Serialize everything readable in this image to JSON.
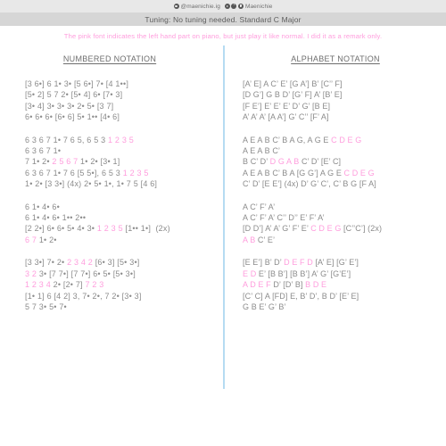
{
  "credit": {
    "handle": "@maenichie.ig",
    "name": "Maenichie",
    "icons": [
      "instagram-icon",
      "youtube-icon",
      "facebook-icon",
      "tiktok-icon"
    ]
  },
  "tuning": {
    "text": "Tuning: No tuning needed. Standard C Major"
  },
  "remark": {
    "text": "The pink font indicates the left hand part on piano, but just play it like normal. I did it as a remark only."
  },
  "colors": {
    "pink": "#ff9ddd",
    "gray_text": "#8c8c8c",
    "divider": "#b5dbf2",
    "credit_bar": "#e8e8e8",
    "tuning_bar": "#d6d6d6"
  },
  "columns": {
    "numbered": {
      "title": "NUMBERED NOTATION",
      "blocks": [
        {
          "lines": [
            [
              {
                "t": "[3 6•] 6 1• 3• [5 6•] 7• [4 1••]",
                "c": "gray"
              }
            ],
            [
              {
                "t": "[5• 2] 5 7 2• [5• 4] 6• [7• 3]",
                "c": "gray"
              }
            ],
            [
              {
                "t": "[3• 4] 3• 3• 3• 2• 5• [3 7]",
                "c": "gray"
              }
            ],
            [
              {
                "t": "6• 6• 6• [6• 6] 5• 1•• [4• 6]",
                "c": "gray"
              }
            ]
          ]
        },
        {
          "lines": [
            [
              {
                "t": "6 3 6 7 1• 7 6 5, 6 5 3 ",
                "c": "gray"
              },
              {
                "t": "1 2 3 5",
                "c": "pink"
              }
            ],
            [
              {
                "t": "6 3 6 7 1•",
                "c": "gray"
              }
            ],
            [
              {
                "t": "7 1• 2• ",
                "c": "gray"
              },
              {
                "t": "2 5 6 7",
                "c": "pink"
              },
              {
                "t": " 1• 2• [3• 1]",
                "c": "gray"
              }
            ],
            [
              {
                "t": "6 3 6 7 1• 7 6 [5 5•], 6 5 3 ",
                "c": "gray"
              },
              {
                "t": "1 2 3 5",
                "c": "pink"
              }
            ],
            [
              {
                "t": "1• 2• [3 3•] (4x) 2• 5• 1•, 1• 7 5 [4 6]",
                "c": "gray"
              }
            ]
          ]
        },
        {
          "lines": [
            [
              {
                "t": "6 1• 4• 6•",
                "c": "gray"
              }
            ],
            [
              {
                "t": "6 1• 4• 6• 1•• 2••",
                "c": "gray"
              }
            ],
            [
              {
                "t": "[2 2•] 6• 6• 5• 4• 3• ",
                "c": "gray"
              },
              {
                "t": "1 2 3 5",
                "c": "pink"
              },
              {
                "t": " [1•• 1•]  (2x)",
                "c": "gray"
              }
            ],
            [
              {
                "t": "6 7",
                "c": "pink"
              },
              {
                "t": " 1• 2•",
                "c": "gray"
              }
            ]
          ]
        },
        {
          "lines": [
            [
              {
                "t": "[3 3•] 7• 2• ",
                "c": "gray"
              },
              {
                "t": "2 3 4 2",
                "c": "pink"
              },
              {
                "t": " [6• 3] [5• 3•]",
                "c": "gray"
              }
            ],
            [
              {
                "t": "3 2",
                "c": "pink"
              },
              {
                "t": " 3• [7 7•] [7 7•] 6• 5• [5• 3•]",
                "c": "gray"
              }
            ],
            [
              {
                "t": "1 2 3 4",
                "c": "pink"
              },
              {
                "t": " 2• [2• 7] ",
                "c": "gray"
              },
              {
                "t": "7 2 3",
                "c": "pink"
              }
            ],
            [
              {
                "t": "[1• 1] 6 [4 2] 3, 7• 2•, 7 2• [3• 3]",
                "c": "gray"
              }
            ],
            [
              {
                "t": "5 7 3• 5• 7•",
                "c": "gray"
              }
            ]
          ]
        }
      ]
    },
    "alphabet": {
      "title": "ALPHABET NOTATION",
      "blocks": [
        {
          "lines": [
            [
              {
                "t": "[A’ E] A C’ E’ [G A’] B’ [C’’ F]",
                "c": "gray"
              }
            ],
            [
              {
                "t": "[D G’] G B D’ [G’ F] A’ [B’ E]",
                "c": "gray"
              }
            ],
            [
              {
                "t": "[F E’] E’ E’ E’ D’ G’ [B E]",
                "c": "gray"
              }
            ],
            [
              {
                "t": "A’ A’ A’ [A A’] G’ C’’ [F’ A]",
                "c": "gray"
              }
            ]
          ]
        },
        {
          "lines": [
            [
              {
                "t": "A E A B C’ B A G, A G E ",
                "c": "gray"
              },
              {
                "t": "C D E G",
                "c": "pink"
              }
            ],
            [
              {
                "t": "A E A B C’",
                "c": "gray"
              }
            ],
            [
              {
                "t": "B C’ D’ ",
                "c": "gray"
              },
              {
                "t": "D G A B",
                "c": "pink"
              },
              {
                "t": " C’ D’ [E’ C]",
                "c": "gray"
              }
            ],
            [
              {
                "t": "A E A B C’ B A [G G’] A G E ",
                "c": "gray"
              },
              {
                "t": "C D E G",
                "c": "pink"
              }
            ],
            [
              {
                "t": "C’ D’ [E E’] (4x) D’ G’ C’, C’ B G [F A]",
                "c": "gray"
              }
            ]
          ]
        },
        {
          "lines": [
            [
              {
                "t": "A C’ F’ A’",
                "c": "gray"
              }
            ],
            [
              {
                "t": "A C’ F’ A’ C’’ D’’ E’ F’ A’",
                "c": "gray"
              }
            ],
            [
              {
                "t": "[D D’] A’ A’ G’ F’ E’ ",
                "c": "gray"
              },
              {
                "t": "C D E G",
                "c": "pink"
              },
              {
                "t": " [C’’C’] (2x)",
                "c": "gray"
              }
            ],
            [
              {
                "t": "A B",
                "c": "pink"
              },
              {
                "t": " C’ E’",
                "c": "gray"
              }
            ]
          ]
        },
        {
          "lines": [
            [
              {
                "t": "[E E’] B’ D’ ",
                "c": "gray"
              },
              {
                "t": "D E F D",
                "c": "pink"
              },
              {
                "t": " [A’ E] [G’ E’]",
                "c": "gray"
              }
            ],
            [
              {
                "t": "E D",
                "c": "pink"
              },
              {
                "t": " E’ [B B’] [B B’] A’ G’ [G’E’]",
                "c": "gray"
              }
            ],
            [
              {
                "t": "A D E F",
                "c": "pink"
              },
              {
                "t": " D’ [D’ B] ",
                "c": "gray"
              },
              {
                "t": "B D E",
                "c": "pink"
              }
            ],
            [
              {
                "t": "[C’ C] A [FD] E, B’ D’, B D’ [E’ E]",
                "c": "gray"
              }
            ],
            [
              {
                "t": "G B E’ G’ B’",
                "c": "gray"
              }
            ]
          ]
        }
      ]
    }
  }
}
